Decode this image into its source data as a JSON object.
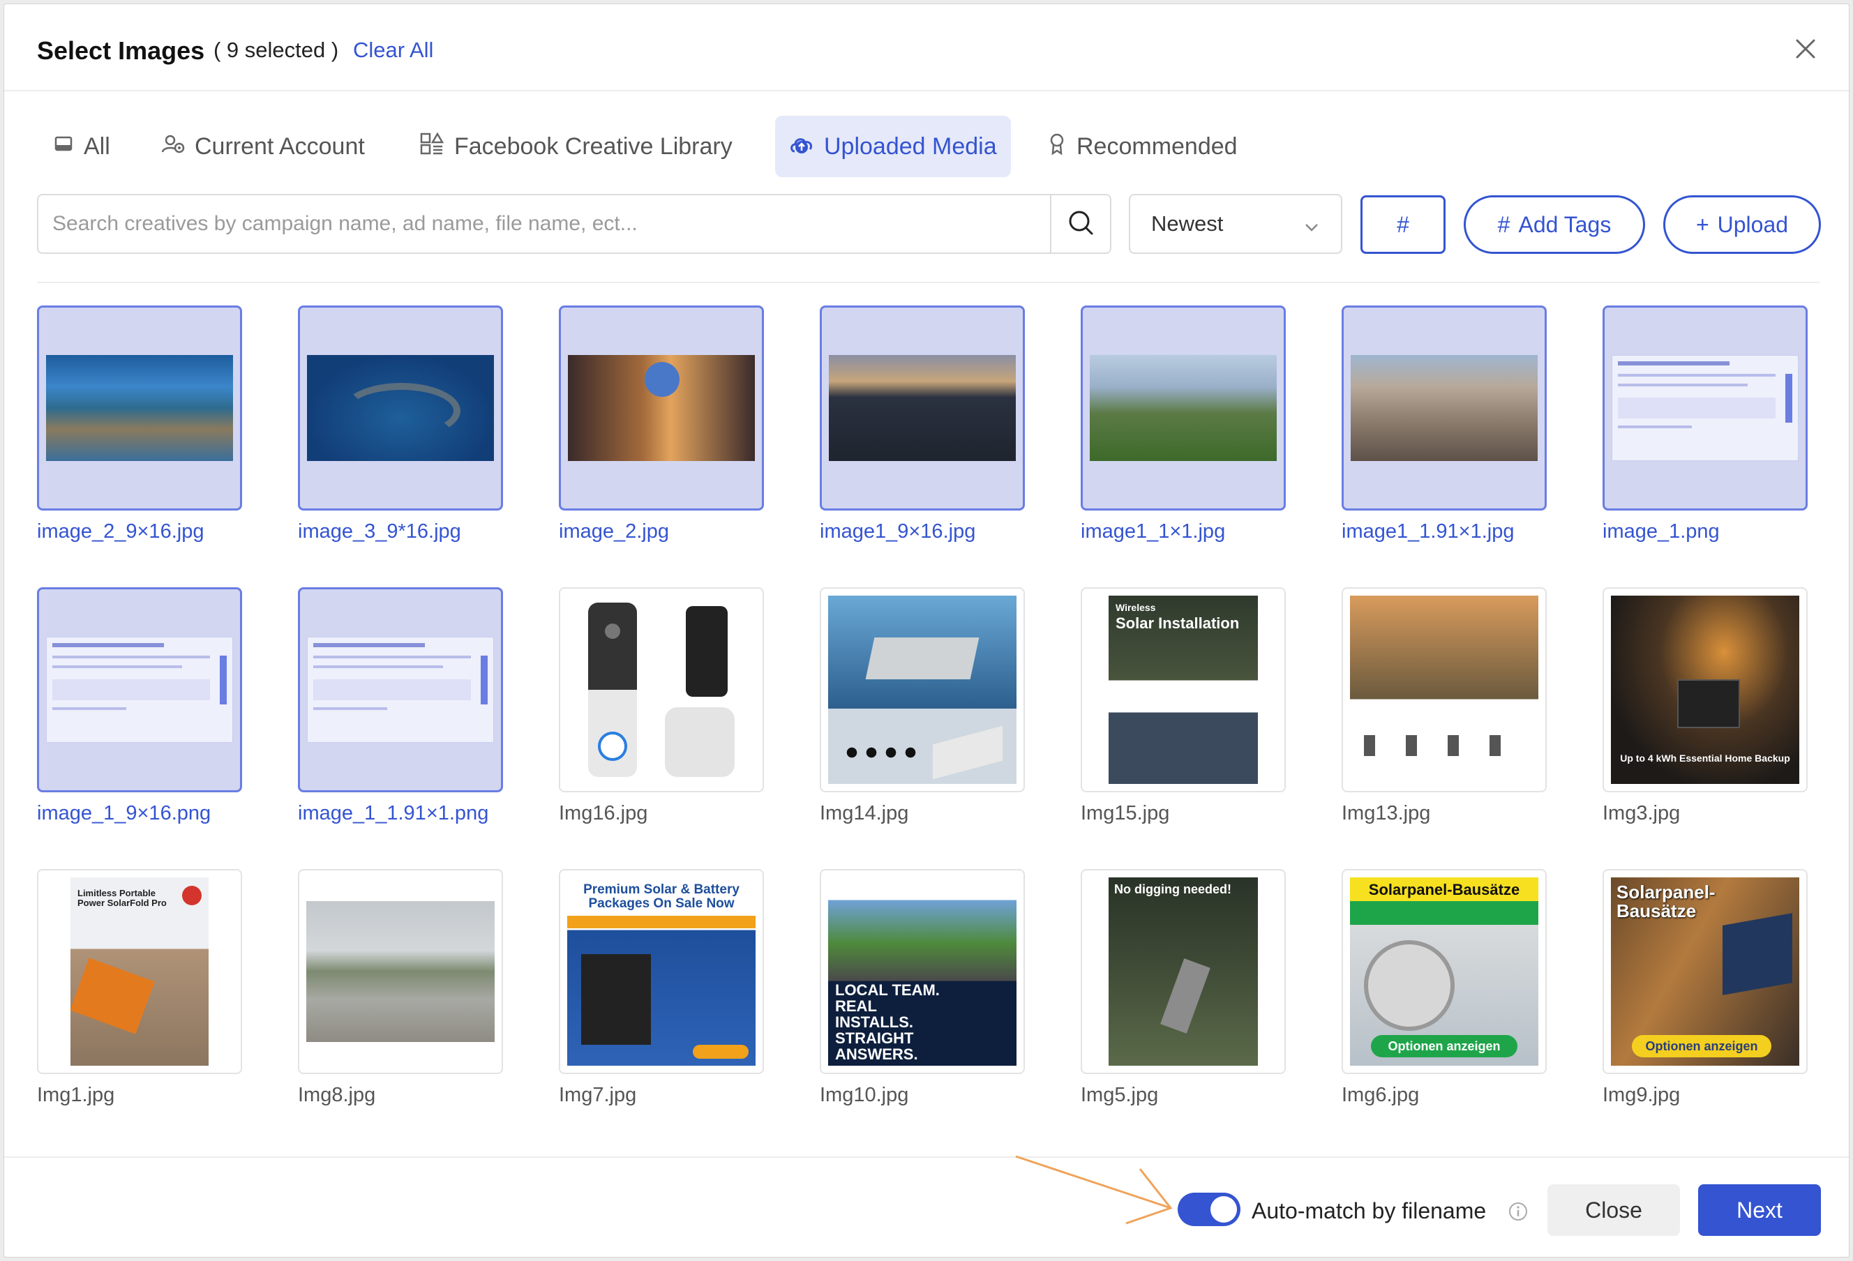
{
  "header": {
    "title": "Select Images",
    "selected_count": "( 9 selected )",
    "clear_all": "Clear All"
  },
  "tabs": [
    {
      "label": "All",
      "icon": "image-icon",
      "active": false
    },
    {
      "label": "Current Account",
      "icon": "account-icon",
      "active": false
    },
    {
      "label": "Facebook Creative Library",
      "icon": "library-icon",
      "active": false
    },
    {
      "label": "Uploaded Media",
      "icon": "upload-cloud-icon",
      "active": true
    },
    {
      "label": "Recommended",
      "icon": "award-icon",
      "active": false
    }
  ],
  "toolbar": {
    "search_placeholder": "Search creatives by campaign name, ad name, file name, ect...",
    "sort_value": "Newest",
    "hash_label": "#",
    "add_tags_label": "Add Tags",
    "upload_label": "Upload"
  },
  "images": [
    {
      "name": "image_2_9×16.jpg",
      "selected": true,
      "thumb": "reef"
    },
    {
      "name": "image_3_9*16.jpg",
      "selected": true,
      "thumb": "island"
    },
    {
      "name": "image_2.jpg",
      "selected": true,
      "thumb": "street"
    },
    {
      "name": "image1_9×16.jpg",
      "selected": true,
      "thumb": "vineyard"
    },
    {
      "name": "image1_1×1.jpg",
      "selected": true,
      "thumb": "meadow"
    },
    {
      "name": "image1_1.91×1.jpg",
      "selected": true,
      "thumb": "rocks"
    },
    {
      "name": "image_1.png",
      "selected": true,
      "thumb": "ui-screenshot"
    },
    {
      "name": "image_1_9×16.png",
      "selected": true,
      "thumb": "ui-screenshot"
    },
    {
      "name": "image_1_1.91×1.png",
      "selected": true,
      "thumb": "ui-screenshot"
    },
    {
      "name": "Img16.jpg",
      "selected": false,
      "thumb": "doorbell"
    },
    {
      "name": "Img14.jpg",
      "selected": false,
      "thumb": "device"
    },
    {
      "name": "Img15.jpg",
      "selected": false,
      "thumb": "solar-install",
      "caption_small": "Wireless",
      "caption": "Solar Installation"
    },
    {
      "name": "Img13.jpg",
      "selected": false,
      "thumb": "family"
    },
    {
      "name": "Img3.jpg",
      "selected": false,
      "thumb": "backup",
      "caption": "Up to 4 kWh Essential Home Backup"
    },
    {
      "name": "Img1.jpg",
      "selected": false,
      "thumb": "solar-panel",
      "caption": "Limitless Portable Power SolarFold Pro"
    },
    {
      "name": "Img8.jpg",
      "selected": false,
      "thumb": "field"
    },
    {
      "name": "Img7.jpg",
      "selected": false,
      "thumb": "apollo",
      "caption": "Premium Solar & Battery Packages On Sale Now"
    },
    {
      "name": "Img10.jpg",
      "selected": false,
      "thumb": "perth",
      "caption": "LOCAL TEAM. REAL INSTALLS. STRAIGHT ANSWERS."
    },
    {
      "name": "Img5.jpg",
      "selected": false,
      "thumb": "aerial",
      "caption": "No digging needed!"
    },
    {
      "name": "Img6.jpg",
      "selected": false,
      "thumb": "meter",
      "caption": "Solarpanel-Bausätze",
      "cta": "Optionen anzeigen"
    },
    {
      "name": "Img9.jpg",
      "selected": false,
      "thumb": "workshop",
      "caption": "Solarpanel-Bausätze",
      "cta": "Optionen anzeigen"
    }
  ],
  "footer": {
    "toggle_label": "Auto-match by filename",
    "toggle_on": true,
    "close_label": "Close",
    "next_label": "Next"
  },
  "colors": {
    "accent": "#3454d1",
    "selected_bg": "#d2d6f1",
    "annotation_arrow": "#f0a35a"
  }
}
